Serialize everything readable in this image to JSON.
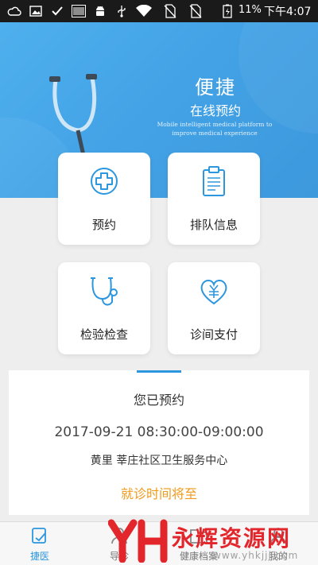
{
  "status_bar": {
    "battery_percent": "11%",
    "time": "下午4:07"
  },
  "hero": {
    "title": "便捷",
    "subtitle": "在线预约",
    "tagline": "Mobile intelligent medical platform to improve medical experience"
  },
  "cards": [
    {
      "label": "预约",
      "icon": "medical-cross-icon"
    },
    {
      "label": "排队信息",
      "icon": "clipboard-icon"
    },
    {
      "label": "检验检查",
      "icon": "stethoscope-icon"
    },
    {
      "label": "诊间支付",
      "icon": "heart-yuan-icon"
    }
  ],
  "appointment": {
    "title": "您已预约",
    "time": "2017-09-21 08:30:00-09:00:00",
    "place": "黄里 莘庄社区卫生服务中心",
    "status": "就诊时间将至"
  },
  "bottom_nav": [
    {
      "label": "捷医",
      "active": true
    },
    {
      "label": "导诊",
      "active": false
    },
    {
      "label": "健康档案",
      "active": false
    },
    {
      "label": "我的",
      "active": false
    }
  ],
  "watermark": {
    "text": "永辉资源网",
    "url": "www.yhkjjj.com"
  },
  "colors": {
    "accent": "#2c97de",
    "hero_blue": "#43a3e6",
    "status_orange": "#f19a1a",
    "watermark_red": "#e3262c"
  }
}
